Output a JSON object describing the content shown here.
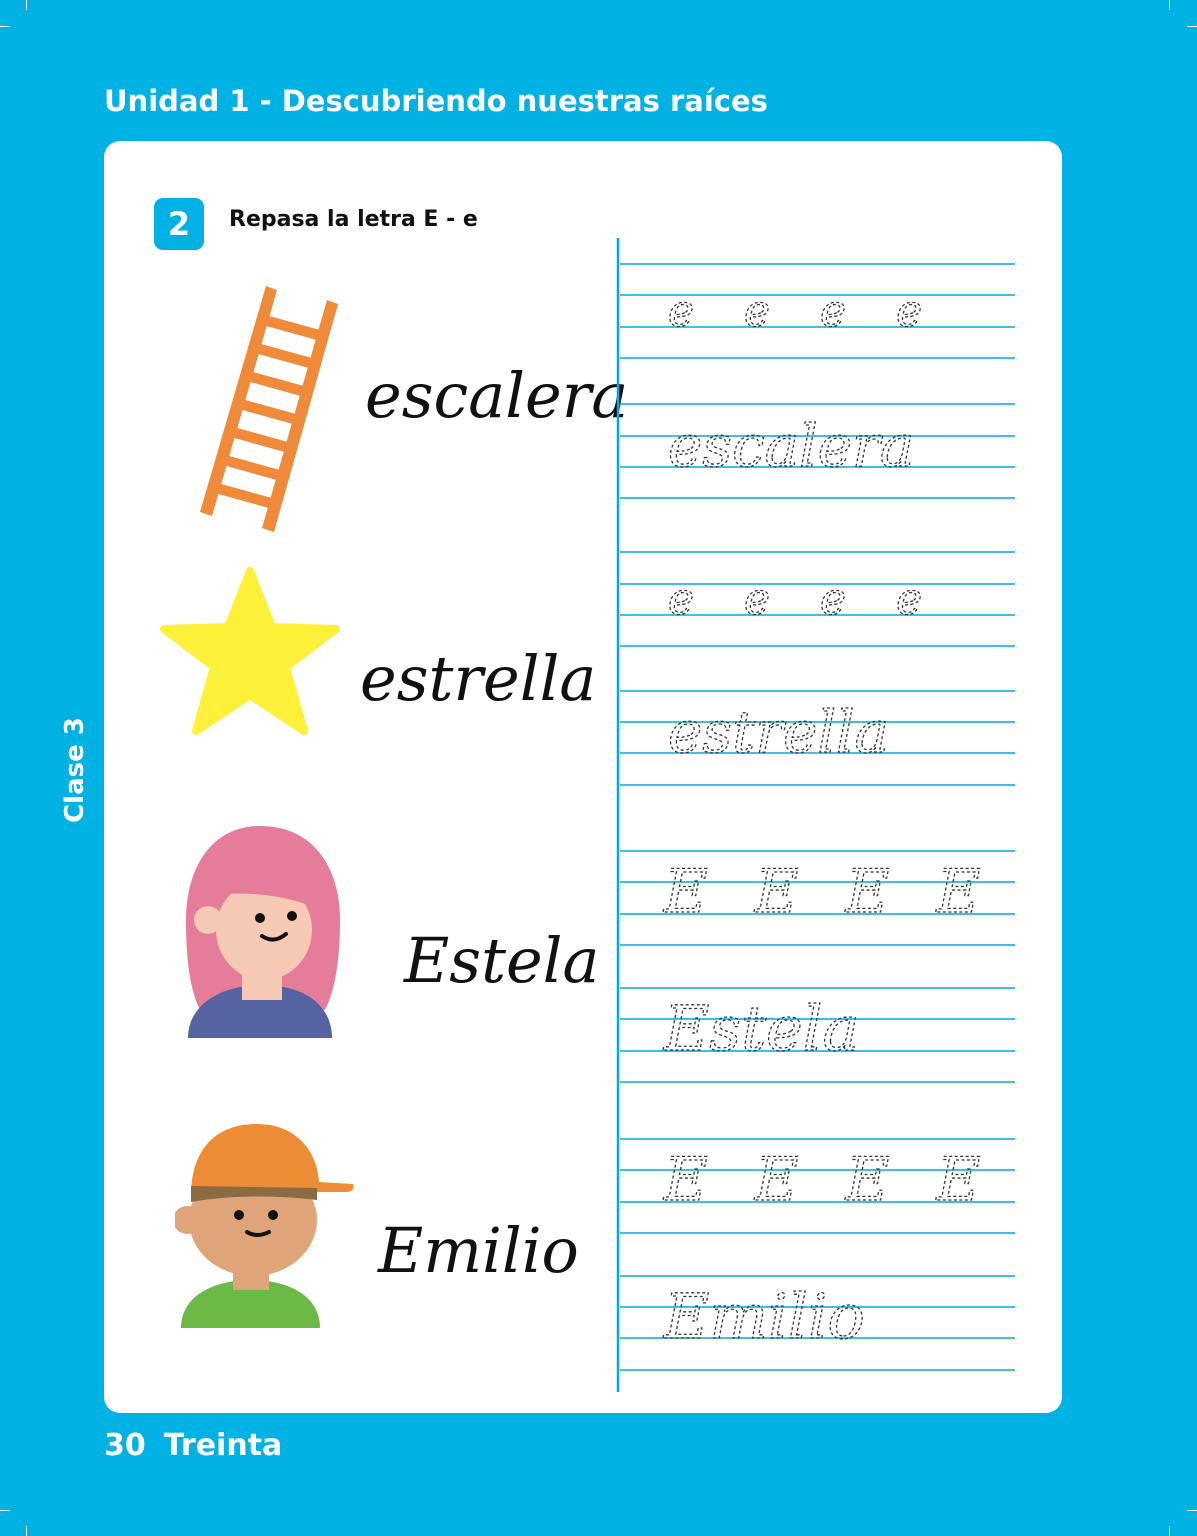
{
  "header": {
    "unit_title": "Unidad 1 - Descubriendo nuestras raíces"
  },
  "side_tab": {
    "label": "Clase 3"
  },
  "exercise": {
    "number": "2",
    "instruction": "Repasa la letra  E - e"
  },
  "words": [
    {
      "text": "escalera",
      "picture": "ladder"
    },
    {
      "text": "estrella",
      "picture": "star"
    },
    {
      "text": "Estela",
      "picture": "girl"
    },
    {
      "text": "Emilio",
      "picture": "boy"
    }
  ],
  "practice": [
    {
      "letters": "e e e e",
      "word": "escalera"
    },
    {
      "letters": "e e e e",
      "word": "estrella"
    },
    {
      "letters": "E E E E",
      "word": "Estela"
    },
    {
      "letters": "E E E E",
      "word": "Emilio"
    }
  ],
  "footer": {
    "page_number": "30",
    "page_word": "Treinta"
  },
  "colors": {
    "background": "#00b2e3",
    "card": "#ffffff",
    "ruled_line": "#00a9df",
    "ladder": "#ef8a3a",
    "star": "#fff03a",
    "girl_hair": "#e57c9a",
    "girl_shirt": "#5563a0",
    "boy_cap": "#ee8c35",
    "boy_shirt": "#6cb946",
    "skin": "#f6c9b4",
    "boy_skin": "#e0a479"
  }
}
